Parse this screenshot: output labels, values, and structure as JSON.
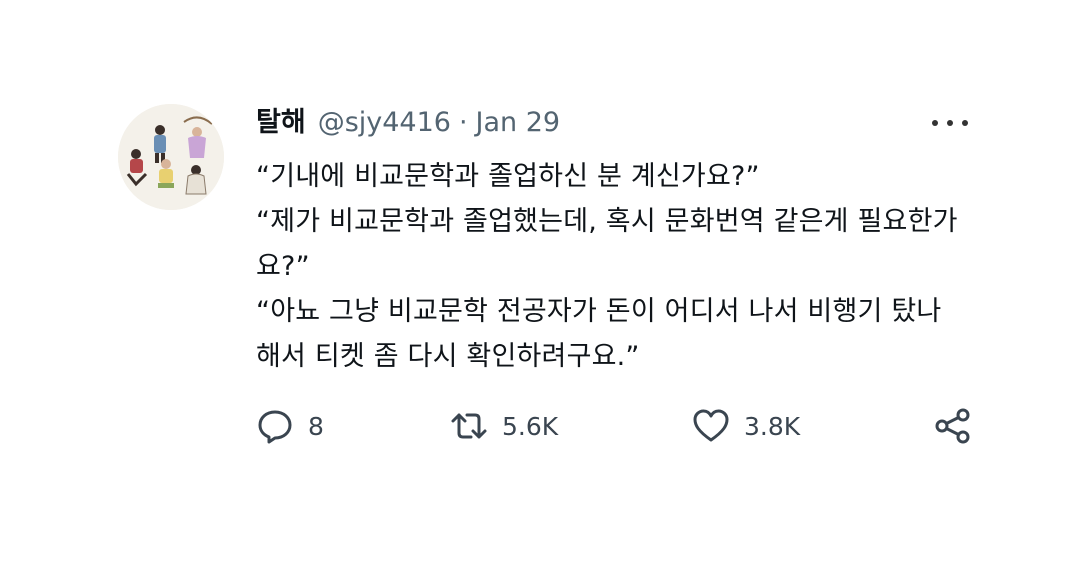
{
  "tweet": {
    "author_name": "탈해",
    "handle": "@sjy4416",
    "separator": "·",
    "date": "Jan 29",
    "body_lines": [
      "“기내에 비교문학과 졸업하신 분 계신가요?”",
      "“제가 비교문학과 졸업했는데, 혹시 문화번역 같은게 필요한가요?”",
      "“아뇨 그냥 비교문학 전공자가 돈이 어디서 나서 비행기 탔나 해서 티켓 좀 다시 확인하려구요.”"
    ],
    "replies": "8",
    "retweets": "5.6K",
    "likes": "3.8K"
  },
  "icons": {
    "reply": "reply-bubble-icon",
    "retweet": "retweet-icon",
    "like": "heart-icon",
    "share": "share-icon",
    "more": "more-dots-icon"
  },
  "colors": {
    "text": "#0f1419",
    "secondary": "#536471",
    "icon": "#3a4550"
  }
}
